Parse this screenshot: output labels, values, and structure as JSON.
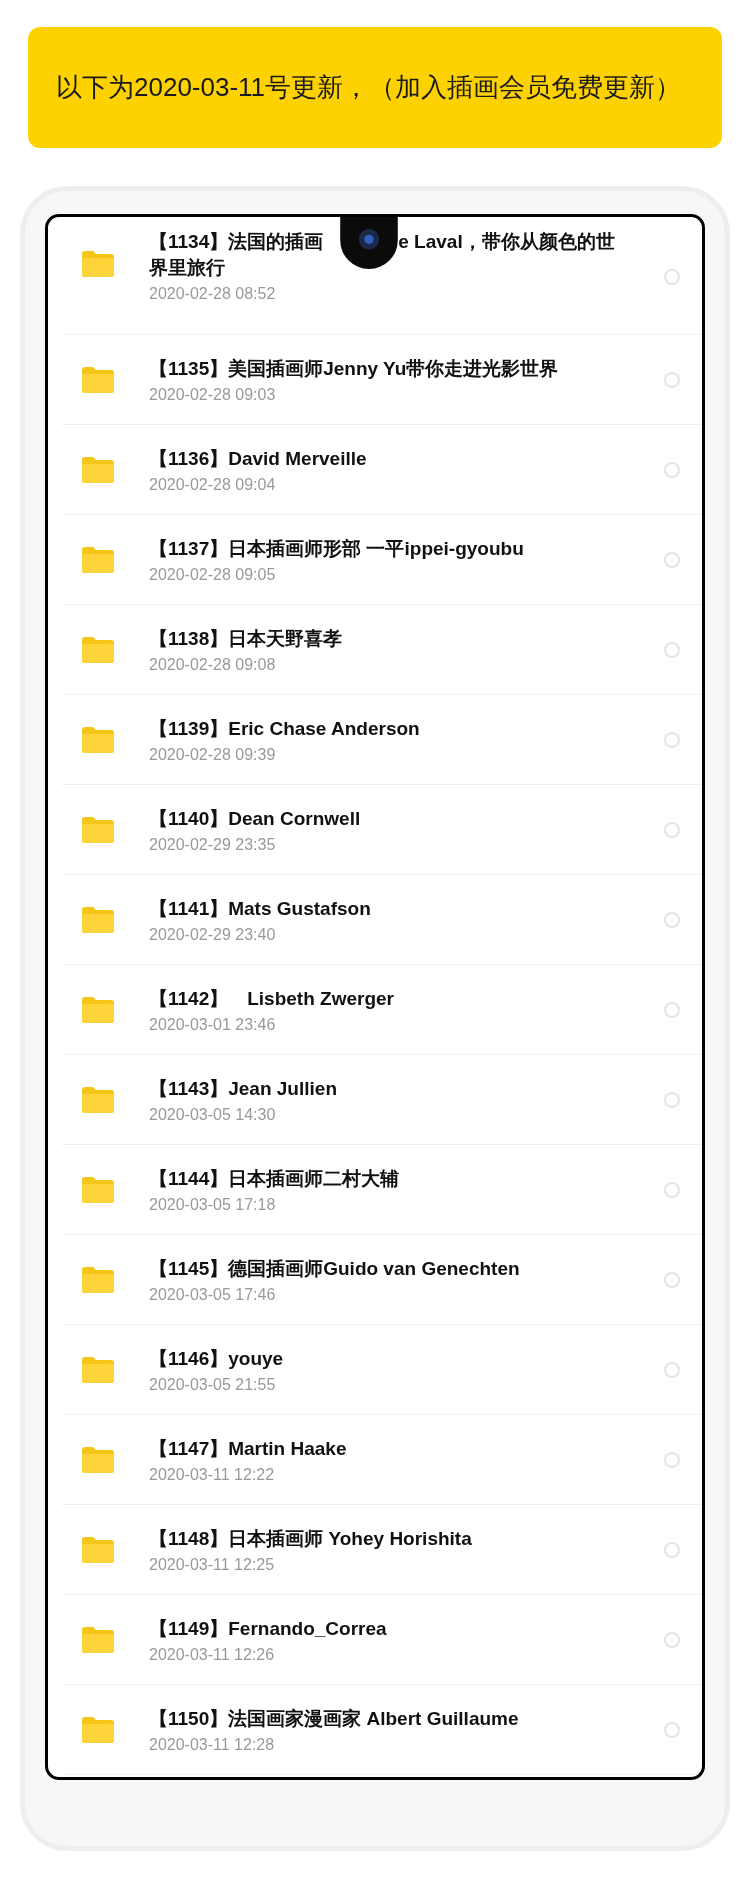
{
  "banner": {
    "text": "以下为2020-03-11号更新，（加入插画会员免费更新）"
  },
  "files": [
    {
      "title_parts": [
        "【1134】法国的插画",
        "e Laval，带你从颜色的世"
      ],
      "title_more": "界里旅行",
      "date": "2020-02-28  08:52",
      "selected": false
    },
    {
      "title_parts": [
        "【1135】美国插画师Jenny Yu带你走进光影世界"
      ],
      "date": "2020-02-28  09:03",
      "selected": false
    },
    {
      "title_parts": [
        "【1136】David Merveille"
      ],
      "date": "2020-02-28  09:04",
      "selected": false
    },
    {
      "title_parts": [
        "【1137】日本插画师形部 一平ippei-gyoubu"
      ],
      "date": "2020-02-28  09:05",
      "selected": false
    },
    {
      "title_parts": [
        "【1138】日本天野喜孝"
      ],
      "date": "2020-02-28  09:08",
      "selected": false
    },
    {
      "title_parts": [
        "【1139】Eric Chase Anderson"
      ],
      "date": "2020-02-28  09:39",
      "selected": false
    },
    {
      "title_parts": [
        "【1140】Dean Cornwell"
      ],
      "date": "2020-02-29  23:35",
      "selected": false
    },
    {
      "title_parts": [
        "【1141】Mats Gustafson"
      ],
      "date": "2020-02-29  23:40",
      "selected": false
    },
    {
      "title_parts": [
        "【1142】　Lisbeth Zwerger"
      ],
      "date": "2020-03-01  23:46",
      "selected": false
    },
    {
      "title_parts": [
        "【1143】Jean Jullien"
      ],
      "date": "2020-03-05  14:30",
      "selected": false
    },
    {
      "title_parts": [
        "【1144】日本插画师二村大辅"
      ],
      "date": "2020-03-05  17:18",
      "selected": false
    },
    {
      "title_parts": [
        "【1145】德国插画师Guido van Genechten"
      ],
      "date": "2020-03-05  17:46",
      "selected": false
    },
    {
      "title_parts": [
        "【1146】youye"
      ],
      "date": "2020-03-05  21:55",
      "selected": false
    },
    {
      "title_parts": [
        "【1147】Martin Haake"
      ],
      "date": "2020-03-11  12:22",
      "selected": false
    },
    {
      "title_parts": [
        "【1148】日本插画师 Yohey Horishita"
      ],
      "date": "2020-03-11  12:25",
      "selected": false
    },
    {
      "title_parts": [
        "【1149】Fernando_Correa"
      ],
      "date": "2020-03-11  12:26",
      "selected": false
    },
    {
      "title_parts": [
        "【1150】法国画家漫画家 Albert Guillaume"
      ],
      "date": "2020-03-11  12:28",
      "selected": false
    }
  ]
}
